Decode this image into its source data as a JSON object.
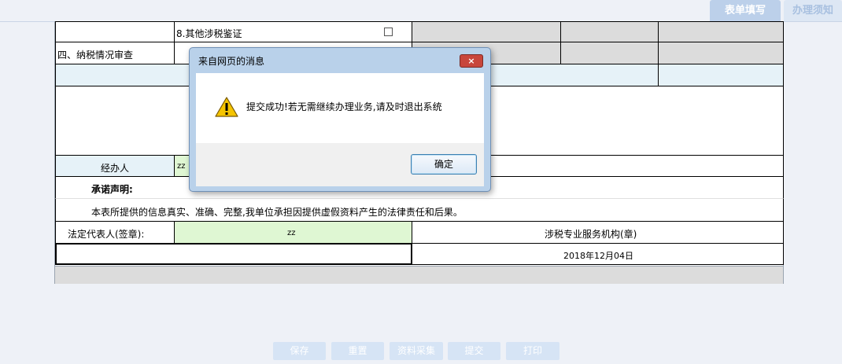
{
  "top_tabs": {
    "active": "表单填写",
    "inactive": "办理须知"
  },
  "form": {
    "item8_label": "8.其他涉税鉴证",
    "section4_label": "四、纳税情况审查",
    "handler_label": "经办人",
    "handler_value": "zz",
    "promise_title": "承诺声明:",
    "promise_text": "本表所提供的信息真实、准确、完整,我单位承担因提供虚假资料产生的法律责任和后果。",
    "legal_rep_label": "法定代表人(签章):",
    "legal_rep_value": "zz",
    "agency_label": "涉税专业服务机构(章)",
    "date_value": "2018年12月04日"
  },
  "buttons": [
    "保存",
    "重置",
    "资料采集",
    "提交",
    "打印"
  ],
  "dialog": {
    "title": "来自网页的消息",
    "close_icon": "×",
    "message": "提交成功!若无需继续办理业务,请及时退出系统",
    "ok_label": "确定"
  },
  "colors": {
    "active_tab": "#bcd0ea",
    "green_cell": "#dff7d3",
    "gray_cell": "#dcdcdc",
    "dialog_frame": "#b9d1ea",
    "close_red": "#c8463c"
  }
}
